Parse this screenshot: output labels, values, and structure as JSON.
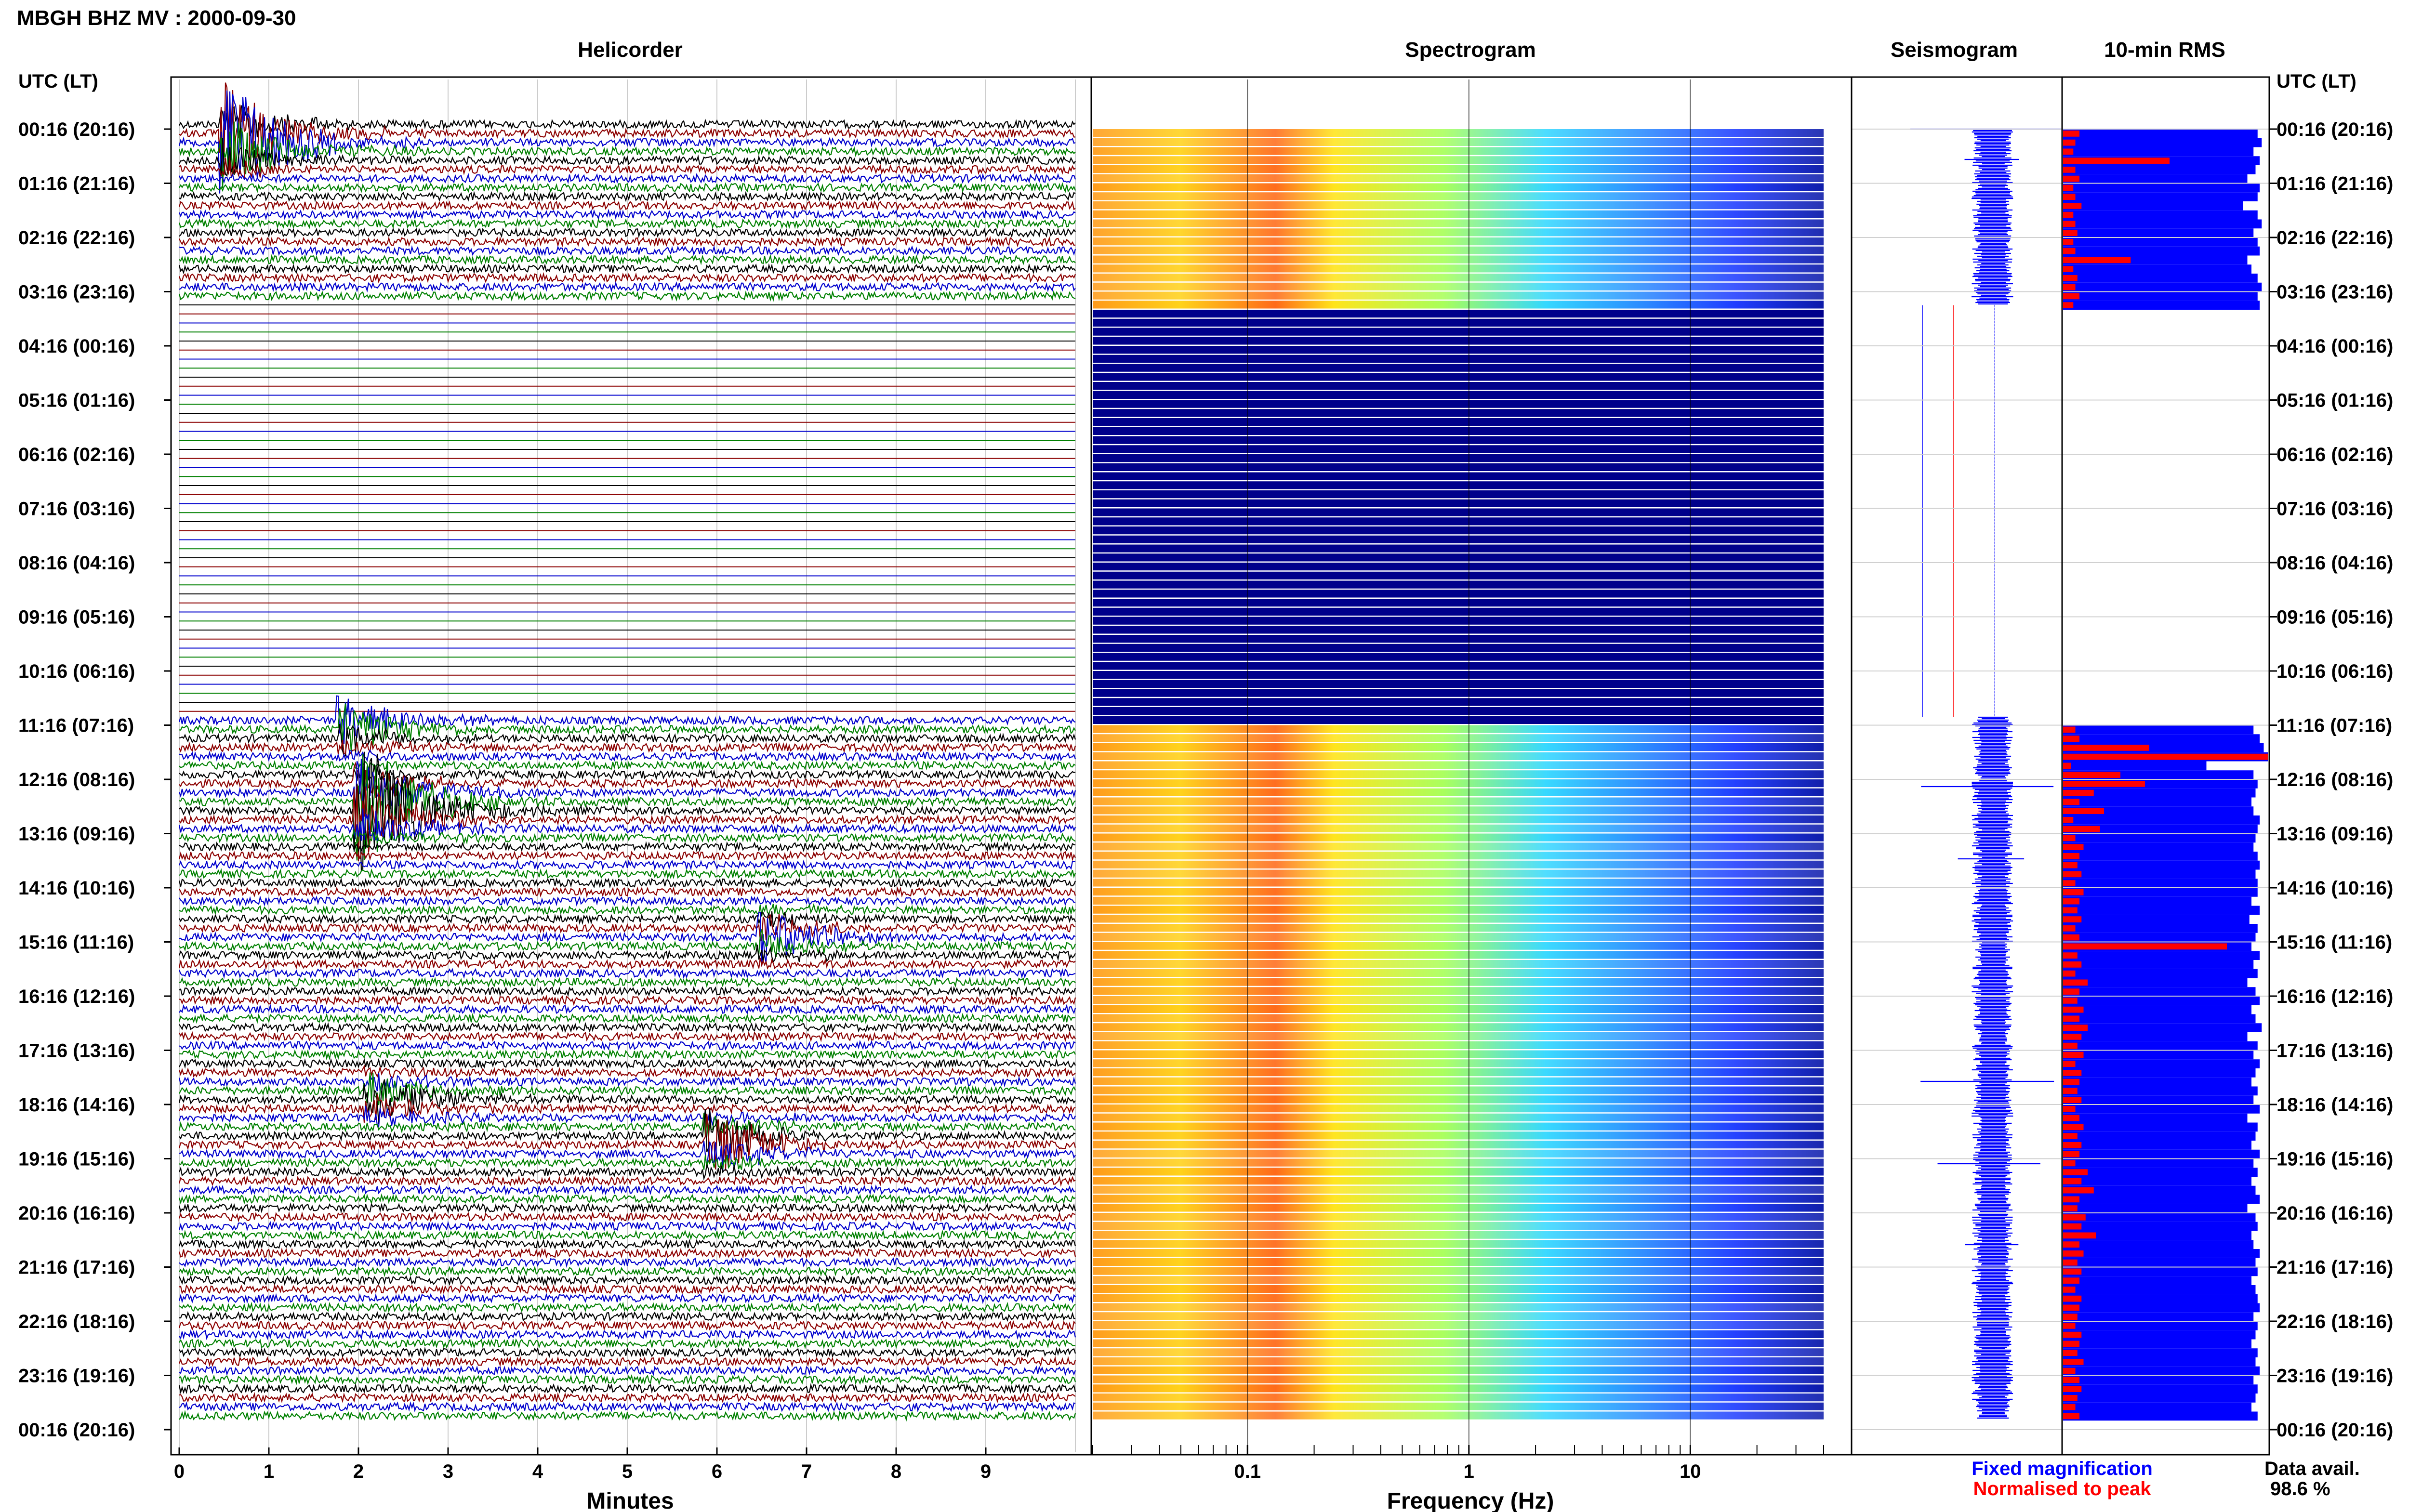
{
  "header": {
    "title": "MBGH BHZ MV : 2000-09-30",
    "utc_label": "UTC (LT)",
    "utc_label_right": "UTC (LT)"
  },
  "panels": {
    "helicorder": "Helicorder",
    "spectrogram": "Spectrogram",
    "seismogram": "Seismogram",
    "rms": "10-min RMS"
  },
  "axes": {
    "minutes_label": "Minutes",
    "frequency_label": "Frequency (Hz)"
  },
  "legend": {
    "fixed": "Fixed magnification",
    "normalised": "Normalised to peak",
    "fixed_color": "#0000ff",
    "normalised_color": "#ff0000"
  },
  "data_avail": {
    "label": "Data avail.",
    "value": "98.6 %"
  },
  "colors": {
    "trace_cycle": [
      "#000000",
      "#8b0000",
      "#0000cd",
      "#008000"
    ],
    "spectrogram_empty": "#00008b",
    "rms_fixed": "#0000ff",
    "rms_norm": "#ff0000"
  },
  "chart_data": [
    {
      "type": "line",
      "title": "Helicorder",
      "xlabel": "Minutes",
      "x_ticks": [
        "0",
        "1",
        "2",
        "3",
        "4",
        "5",
        "6",
        "7",
        "8",
        "9"
      ],
      "xlim": [
        0,
        10
      ],
      "time_labels": [
        "00:16 (20:16)",
        "01:16 (21:16)",
        "02:16 (22:16)",
        "03:16 (23:16)",
        "04:16 (00:16)",
        "05:16 (01:16)",
        "06:16 (02:16)",
        "07:16 (03:16)",
        "08:16 (04:16)",
        "09:16 (05:16)",
        "10:16 (06:16)",
        "11:16 (07:16)",
        "12:16 (08:16)",
        "13:16 (09:16)",
        "14:16 (10:16)",
        "15:16 (11:16)",
        "16:16 (12:16)",
        "17:16 (13:16)",
        "18:16 (14:16)",
        "19:16 (15:16)",
        "20:16 (16:16)",
        "21:16 (17:16)",
        "22:16 (18:16)",
        "23:16 (19:16)",
        "00:16 (20:16)"
      ],
      "gap_hours": [
        3.25,
        10.85
      ],
      "events": [
        {
          "hour": 0.3,
          "minute": 0.5,
          "amp": 3.0
        },
        {
          "hour": 11.1,
          "minute": 1.8,
          "amp": 1.4
        },
        {
          "hour": 12.6,
          "minute": 2.0,
          "amp": 3.5
        },
        {
          "hour": 15.0,
          "minute": 6.5,
          "amp": 1.0
        },
        {
          "hour": 18.0,
          "minute": 2.1,
          "amp": 1.2
        },
        {
          "hour": 18.8,
          "minute": 5.9,
          "amp": 1.5
        }
      ]
    },
    {
      "type": "heatmap",
      "title": "Spectrogram",
      "xlabel": "Frequency (Hz)",
      "x_scale": "log",
      "x_ticks": [
        "0.1",
        "1",
        "10"
      ],
      "xlim": [
        0.02,
        40
      ],
      "gap_hours": [
        3.25,
        10.85
      ]
    },
    {
      "type": "line",
      "title": "Seismogram",
      "gap_hours": [
        3.25,
        10.85
      ]
    },
    {
      "type": "bar",
      "title": "10-min RMS",
      "series": [
        {
          "name": "Fixed magnification",
          "values": [
            0.95,
            0.97,
            0.93,
            0.96,
            0.94,
            0.9,
            0.96,
            0.95,
            0.88,
            0.95,
            0.97,
            0.93,
            0.95,
            0.96,
            0.9,
            0.92,
            0.95,
            0.97,
            0.95,
            0.96,
            0.93,
            0.96,
            0.98,
            1.0,
            0.7,
            0.93,
            0.95,
            0.94,
            0.92,
            0.93,
            0.96,
            0.95,
            0.94,
            0.93,
            0.95,
            0.96,
            0.94,
            0.95,
            0.95,
            0.92,
            0.96,
            0.91,
            0.95,
            0.94,
            0.92,
            0.96,
            0.93,
            0.95,
            0.9,
            0.94,
            0.96,
            0.92,
            0.94,
            0.97,
            0.9,
            0.95,
            0.93,
            0.96,
            0.94,
            0.92,
            0.95,
            0.93,
            0.96,
            0.9,
            0.95,
            0.94,
            0.92,
            0.96,
            0.93,
            0.95,
            0.92,
            0.94,
            0.96,
            0.9,
            0.94,
            0.95,
            0.92,
            0.93,
            0.96,
            0.94,
            0.95,
            0.92,
            0.94,
            0.95,
            0.96,
            0.93,
            0.95,
            0.94,
            0.92,
            0.95,
            0.94,
            0.96,
            0.93,
            0.95,
            0.94,
            0.92,
            0.95,
            0.93,
            0.94,
            0.95,
            0.93,
            0.95,
            0.96,
            0.94,
            0.95,
            0.94,
            0.93,
            0.95,
            0.94,
            0.95,
            0.96,
            0.94
          ]
        },
        {
          "name": "Normalised to peak",
          "values": [
            0.08,
            0.06,
            0.05,
            0.52,
            0.06,
            0.08,
            0.05,
            0.06,
            0.09,
            0.05,
            0.06,
            0.07,
            0.05,
            0.06,
            0.33,
            0.05,
            0.07,
            0.06,
            0.08,
            0.05,
            0.06,
            0.08,
            0.42,
            1.0,
            0.04,
            0.28,
            0.4,
            0.15,
            0.08,
            0.2,
            0.05,
            0.18,
            0.06,
            0.1,
            0.08,
            0.07,
            0.09,
            0.06,
            0.1,
            0.08,
            0.07,
            0.09,
            0.06,
            0.08,
            0.8,
            0.07,
            0.09,
            0.06,
            0.12,
            0.08,
            0.07,
            0.1,
            0.08,
            0.12,
            0.09,
            0.07,
            0.1,
            0.06,
            0.09,
            0.08,
            0.07,
            0.09,
            0.06,
            0.08,
            0.1,
            0.07,
            0.09,
            0.08,
            0.06,
            0.12,
            0.09,
            0.15,
            0.08,
            0.07,
            0.11,
            0.09,
            0.16,
            0.08,
            0.1,
            0.07,
            0.09,
            0.08,
            0.06,
            0.09,
            0.08,
            0.07,
            0.06,
            0.09,
            0.08,
            0.07,
            0.1,
            0.06,
            0.08,
            0.09,
            0.07,
            0.06,
            0.08,
            0.07,
            0.09,
            0.06,
            0.08,
            0.07,
            0.09,
            0.08,
            0.06,
            0.07,
            0.09,
            0.08,
            0.07,
            0.12,
            0.09,
            0.06
          ]
        }
      ],
      "gap_hours": [
        3.25,
        10.85
      ]
    }
  ]
}
